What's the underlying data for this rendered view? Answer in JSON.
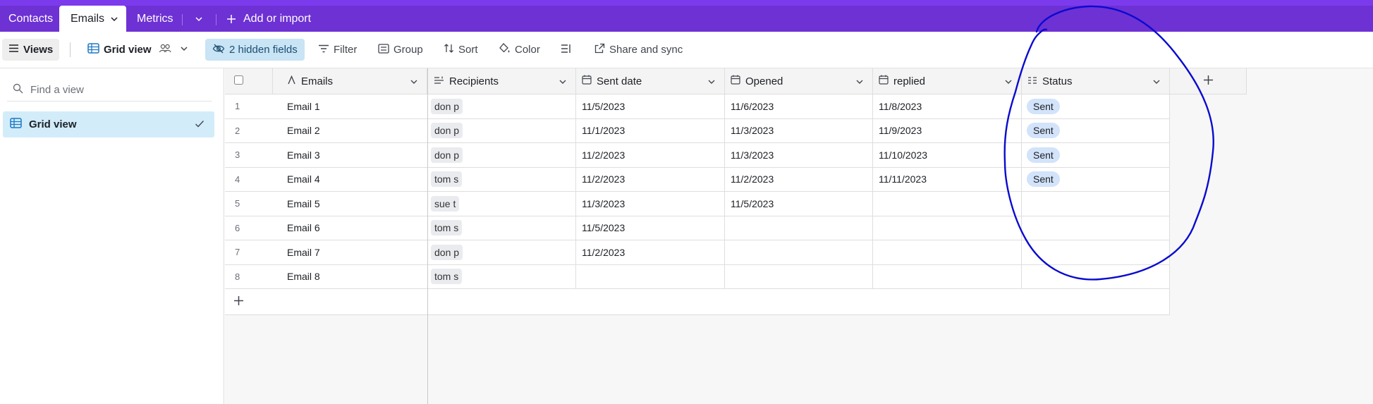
{
  "topbar": {
    "tabs": [
      {
        "label": "Contacts"
      },
      {
        "label": "Emails"
      },
      {
        "label": "Metrics"
      }
    ],
    "add_label": "Add or import"
  },
  "toolbar": {
    "views_label": "Views",
    "grid_view_label": "Grid view",
    "hidden_fields_label": "2 hidden fields",
    "filter_label": "Filter",
    "group_label": "Group",
    "sort_label": "Sort",
    "color_label": "Color",
    "share_label": "Share and sync"
  },
  "sidebar": {
    "find_placeholder": "Find a view",
    "views": [
      {
        "label": "Grid view"
      }
    ]
  },
  "table": {
    "columns": [
      {
        "label": "Emails",
        "icon": "text-icon"
      },
      {
        "label": "Recipients",
        "icon": "link-icon"
      },
      {
        "label": "Sent date",
        "icon": "calendar-icon"
      },
      {
        "label": "Opened",
        "icon": "calendar-icon"
      },
      {
        "label": "replied",
        "icon": "calendar-icon"
      },
      {
        "label": "Status",
        "icon": "single-select-icon"
      }
    ],
    "rows": [
      {
        "num": "1",
        "email": "Email 1",
        "recipient": "don p",
        "sent": "11/5/2023",
        "opened": "11/6/2023",
        "replied": "11/8/2023",
        "status": "Sent"
      },
      {
        "num": "2",
        "email": "Email 2",
        "recipient": "don p",
        "sent": "11/1/2023",
        "opened": "11/3/2023",
        "replied": "11/9/2023",
        "status": "Sent"
      },
      {
        "num": "3",
        "email": "Email 3",
        "recipient": "don p",
        "sent": "11/2/2023",
        "opened": "11/3/2023",
        "replied": "11/10/2023",
        "status": "Sent"
      },
      {
        "num": "4",
        "email": "Email 4",
        "recipient": "tom s",
        "sent": "11/2/2023",
        "opened": "11/2/2023",
        "replied": "11/11/2023",
        "status": "Sent"
      },
      {
        "num": "5",
        "email": "Email 5",
        "recipient": "sue t",
        "sent": "11/3/2023",
        "opened": "11/5/2023",
        "replied": "",
        "status": ""
      },
      {
        "num": "6",
        "email": "Email 6",
        "recipient": "tom s",
        "sent": "11/5/2023",
        "opened": "",
        "replied": "",
        "status": ""
      },
      {
        "num": "7",
        "email": "Email 7",
        "recipient": "don p",
        "sent": "11/2/2023",
        "opened": "",
        "replied": "",
        "status": ""
      },
      {
        "num": "8",
        "email": "Email 8",
        "recipient": "tom s",
        "sent": "",
        "opened": "",
        "replied": "",
        "status": ""
      }
    ]
  },
  "colors": {
    "topbar": "#6e31d4",
    "selected_view": "#d2ecfa",
    "hidden_fields_bg": "#c8e4f5",
    "status_pill": "#d2e3fa",
    "annotation": "#0a0ad0"
  }
}
